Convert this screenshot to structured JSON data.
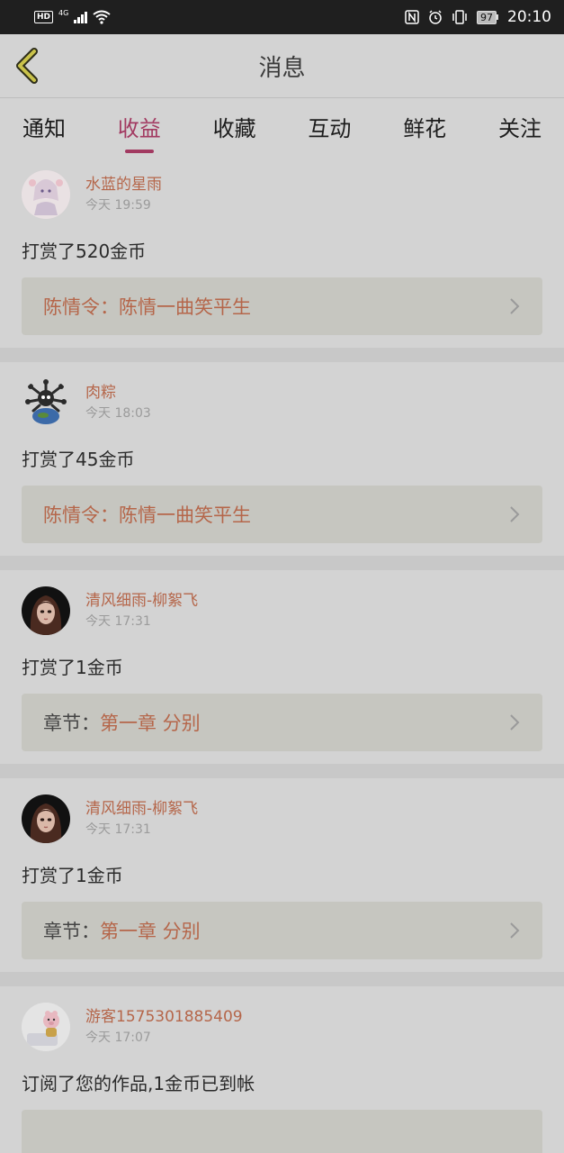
{
  "status_bar": {
    "hd": "HD",
    "network": "4G",
    "battery": "97",
    "time": "20:10"
  },
  "header": {
    "title": "消息"
  },
  "tabs": [
    {
      "label": "通知"
    },
    {
      "label": "收益",
      "active": true
    },
    {
      "label": "收藏"
    },
    {
      "label": "互动"
    },
    {
      "label": "鲜花"
    },
    {
      "label": "关注"
    }
  ],
  "items": [
    {
      "user": "水蓝的星雨",
      "time": "今天 19:59",
      "message": "打赏了520金币",
      "link_label": "陈情令：",
      "link_title": "陈情一曲笑平生",
      "avatar_icon": "anime-girl-avatar"
    },
    {
      "user": "肉粽",
      "time": "今天 18:03",
      "message": "打赏了45金币",
      "link_label": "陈情令：",
      "link_title": "陈情一曲笑平生",
      "avatar_icon": "virus-globe-avatar"
    },
    {
      "user": "清风细雨-柳絮飞",
      "time": "今天 17:31",
      "message": "打赏了1金币",
      "link_label": "章节：",
      "link_title": "第一章 分别",
      "avatar_icon": "doll-girl-avatar"
    },
    {
      "user": "清风细雨-柳絮飞",
      "time": "今天 17:31",
      "message": "打赏了1金币",
      "link_label": "章节：",
      "link_title": "第一章 分别",
      "avatar_icon": "doll-girl-avatar"
    },
    {
      "user": "游客1575301885409",
      "time": "今天 17:07",
      "message": "订阅了您的作品,1金币已到帐",
      "link_label": "",
      "link_title": "",
      "avatar_icon": "toy-pig-avatar"
    }
  ]
}
